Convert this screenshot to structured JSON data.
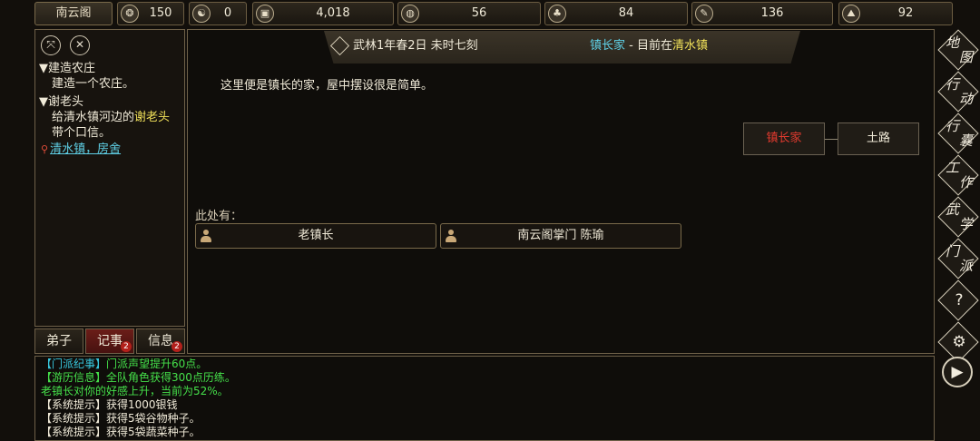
{
  "top_bar": {
    "sect_name": "南云阁",
    "stats": [
      {
        "icon": "prestige-icon",
        "glyph": "❂",
        "value": "150"
      },
      {
        "icon": "yin-yang-icon",
        "glyph": "☯",
        "value": "0"
      },
      {
        "icon": "coin-icon",
        "glyph": "▣",
        "value": "4,018"
      },
      {
        "icon": "grain-bowl-icon",
        "glyph": "◍",
        "value": "56"
      },
      {
        "icon": "herb-icon",
        "glyph": "♣",
        "value": "84"
      },
      {
        "icon": "wood-icon",
        "glyph": "✎",
        "value": "136"
      },
      {
        "icon": "ore-icon",
        "glyph": "⛰",
        "value": "92"
      }
    ]
  },
  "quest_panel": {
    "quests": [
      {
        "title": "▼建造农庄",
        "desc": "建造一个农庄。"
      },
      {
        "title": "▼谢老头",
        "desc_pre": "给清水镇河边的",
        "desc_highlight": "谢老头",
        "desc_post": "带个口信。",
        "location": "清水镇，房舍"
      }
    ]
  },
  "tabs": [
    {
      "label": "弟子",
      "badge": ""
    },
    {
      "label": "记事",
      "badge": "2"
    },
    {
      "label": "信息",
      "badge": "2"
    }
  ],
  "banner": {
    "date": "武林1年春2日 未时七刻",
    "place": "镇长家",
    "separator": " - 目前在",
    "town": "清水镇"
  },
  "scene": {
    "description": "这里便是镇长的家，屋中摆设很是简单。",
    "map_nodes": [
      "镇长家",
      "土路"
    ],
    "here_label": "此处有：",
    "npcs": [
      "老镇长",
      "南云阁掌门 陈瑜"
    ]
  },
  "log": [
    {
      "tag": "【门派纪事】",
      "text": "门派声望提升60点。",
      "tag_color": "cyan",
      "text_color": "green"
    },
    {
      "tag": "【游历信息】",
      "text": "全队角色获得300点历练。",
      "tag_color": "green",
      "text_color": "green"
    },
    {
      "tag": "",
      "text": "老镇长对你的好感上升，当前为52%。",
      "tag_color": "green",
      "text_color": "green"
    },
    {
      "tag": "【系统提示】",
      "text": "获得1000银钱",
      "tag_color": "white",
      "text_color": "white"
    },
    {
      "tag": "【系统提示】",
      "text": "获得5袋谷物种子。",
      "tag_color": "white",
      "text_color": "white"
    },
    {
      "tag": "【系统提示】",
      "text": "获得5袋蔬菜种子。",
      "tag_color": "white",
      "text_color": "white"
    }
  ],
  "side_nav": [
    {
      "name": "map",
      "chars": [
        "地",
        "图"
      ]
    },
    {
      "name": "action",
      "chars": [
        "行",
        "动"
      ]
    },
    {
      "name": "bag",
      "chars": [
        "行",
        "囊"
      ]
    },
    {
      "name": "work",
      "chars": [
        "工",
        "作"
      ]
    },
    {
      "name": "martial",
      "chars": [
        "武",
        "学"
      ]
    },
    {
      "name": "sect",
      "chars": [
        "门",
        "派"
      ]
    },
    {
      "name": "help",
      "symbol": "?"
    },
    {
      "name": "settings",
      "symbol": "⚙"
    },
    {
      "name": "play",
      "symbol": "▶"
    }
  ]
}
